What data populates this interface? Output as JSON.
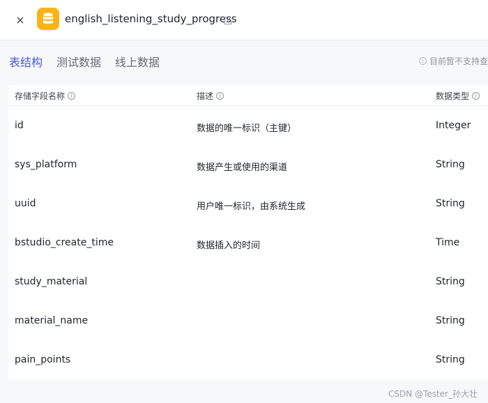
{
  "header": {
    "title": "english_listening_study_progress",
    "close_symbol": "×",
    "icon_color": "#f8b31a"
  },
  "tabs": [
    {
      "label": "表结构",
      "active": true
    },
    {
      "label": "测试数据",
      "active": false
    },
    {
      "label": "线上数据",
      "active": false
    }
  ],
  "notice": "目前暂不支持查",
  "table": {
    "columns": {
      "name": "存储字段名称",
      "desc": "描述",
      "type": "数据类型"
    },
    "rows": [
      {
        "name": "id",
        "desc": "数据的唯一标识（主键）",
        "type": "Integer"
      },
      {
        "name": "sys_platform",
        "desc": "数据产生或使用的渠道",
        "type": "String"
      },
      {
        "name": "uuid",
        "desc": "用户唯一标识，由系统生成",
        "type": "String"
      },
      {
        "name": "bstudio_create_time",
        "desc": "数据插入的时间",
        "type": "Time"
      },
      {
        "name": "study_material",
        "desc": "",
        "type": "String"
      },
      {
        "name": "material_name",
        "desc": "",
        "type": "String"
      },
      {
        "name": "pain_points",
        "desc": "",
        "type": "String"
      }
    ]
  },
  "watermark": "CSDN @Tester_孙大壮",
  "colors": {
    "accent": "#4a55d6",
    "background": "#f7f8fa"
  }
}
